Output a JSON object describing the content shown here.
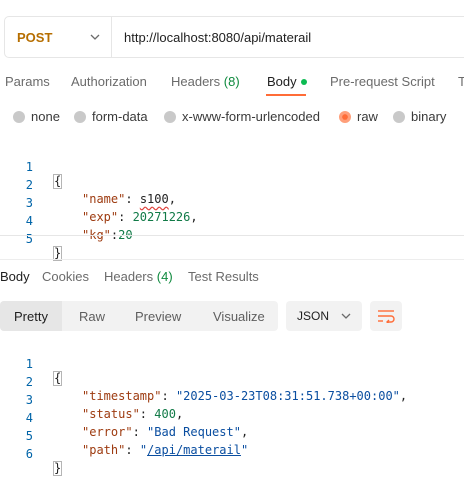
{
  "request": {
    "method": "POST",
    "url": "http://localhost:8080/api/materail"
  },
  "request_tabs": [
    {
      "label": "Params"
    },
    {
      "label": "Authorization"
    },
    {
      "label": "Headers",
      "count": "(8)"
    },
    {
      "label": "Body"
    },
    {
      "label": "Pre-request Script"
    },
    {
      "label": "T"
    }
  ],
  "body_types": [
    "none",
    "form-data",
    "x-www-form-urlencoded",
    "raw",
    "binary"
  ],
  "selected_body_type": "raw",
  "request_body": {
    "line_numbers": [
      "1",
      "2",
      "3",
      "4",
      "5"
    ],
    "open_brace": "{",
    "name_key": "\"name\"",
    "name_colon": ": ",
    "name_value": "s100",
    "name_comma": ",",
    "exp_key": "\"exp\"",
    "exp_colon": ": ",
    "exp_value": "20271226",
    "exp_comma": ",",
    "kg_key": "\"kg\"",
    "kg_colon": ":",
    "kg_value": "20",
    "close_brace": "}"
  },
  "response_tabs": [
    {
      "label": "Body"
    },
    {
      "label": "Cookies"
    },
    {
      "label": "Headers",
      "count": "(4)"
    },
    {
      "label": "Test Results"
    }
  ],
  "view_modes": [
    "Pretty",
    "Raw",
    "Preview",
    "Visualize"
  ],
  "selected_view": "Pretty",
  "format": "JSON",
  "response_body": {
    "line_numbers": [
      "1",
      "2",
      "3",
      "4",
      "5",
      "6"
    ],
    "open_brace": "{",
    "timestamp_key": "\"timestamp\"",
    "timestamp_value": "\"2025-03-23T08:31:51.738+00:00\"",
    "status_key": "\"status\"",
    "status_value": "400",
    "error_key": "\"error\"",
    "error_value": "\"Bad Request\"",
    "path_key": "\"path\"",
    "path_quote_open": "\"",
    "path_value": "/api/materail",
    "path_quote_close": "\"",
    "close_brace": "}"
  },
  "colors": {
    "accent": "#ff6c37",
    "method": "#b66e00",
    "green_status": "#0cbb52"
  },
  "icons": [
    "chevron-down-icon",
    "wrap-lines-icon"
  ]
}
